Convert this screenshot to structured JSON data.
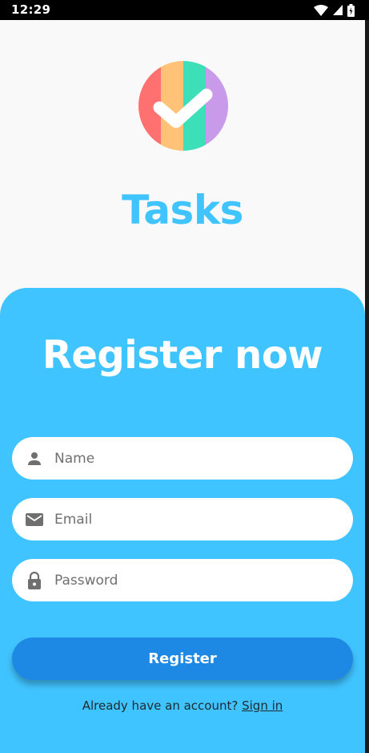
{
  "status_bar": {
    "time": "12:29",
    "icons": [
      "wifi-icon",
      "signal-icon",
      "battery-icon"
    ]
  },
  "app": {
    "name": "Tasks",
    "logo_colors": [
      "#ff7070",
      "#ffc277",
      "#3ddfb8",
      "#c99ae9"
    ],
    "accent": "#40c4ff"
  },
  "form": {
    "title": "Register now",
    "fields": [
      {
        "icon": "person-icon",
        "placeholder": "Name",
        "value": ""
      },
      {
        "icon": "mail-icon",
        "placeholder": "Email",
        "value": ""
      },
      {
        "icon": "lock-icon",
        "placeholder": "Password",
        "value": ""
      }
    ],
    "submit_label": "Register",
    "button_color": "#1e88e5"
  },
  "footer": {
    "prompt": "Already have an account?",
    "link": "Sign in"
  }
}
